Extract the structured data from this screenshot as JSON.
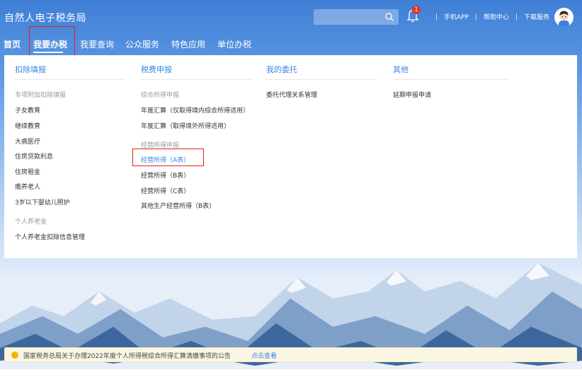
{
  "header": {
    "title": "自然人电子税务局",
    "search_placeholder": "",
    "notification_count": "1",
    "links": [
      "手机APP",
      "帮助中心",
      "下载服务"
    ]
  },
  "nav": {
    "items": [
      "首页",
      "我要办税",
      "我要查询",
      "公众服务",
      "特色应用",
      "单位办税"
    ],
    "active": "我要办税"
  },
  "menu": {
    "columns": [
      {
        "title": "扣除填报",
        "groups": [
          {
            "subtitle": "专项附加扣除填报",
            "links": [
              "子女教育",
              "继续教育",
              "大病医疗",
              "住房贷款利息",
              "住房租金",
              "赡养老人",
              "3岁以下婴幼儿照护"
            ]
          },
          {
            "subtitle": "个人养老金",
            "links": [
              "个人养老金扣除信息管理"
            ]
          }
        ]
      },
      {
        "title": "税费申报",
        "groups": [
          {
            "subtitle": "综合所得申报",
            "links": [
              "年度汇算（仅取得境内综合所得适用）",
              "年度汇算（取得境外所得适用）"
            ]
          },
          {
            "subtitle": "经营所得申报",
            "links": [
              "经营所得（A表）",
              "经营所得（B表）",
              "经营所得（C表）",
              "其他生产经营所得（B表）"
            ]
          }
        ],
        "highlighted_link": "经营所得（A表）"
      },
      {
        "title": "我的委托",
        "groups": [
          {
            "subtitle": "",
            "links": [
              "委托代理关系管理"
            ]
          }
        ]
      },
      {
        "title": "其他",
        "groups": [
          {
            "subtitle": "",
            "links": [
              "延期申报申请"
            ]
          }
        ]
      }
    ]
  },
  "notice": {
    "text": "国家税务总局关于办理2022年度个人所得税综合所得汇算清缴事项的公告",
    "link": "点击查看"
  },
  "colors": {
    "accent": "#3a86e8",
    "highlight_red": "#e0201b",
    "header_blue": "#3f7fd6"
  }
}
